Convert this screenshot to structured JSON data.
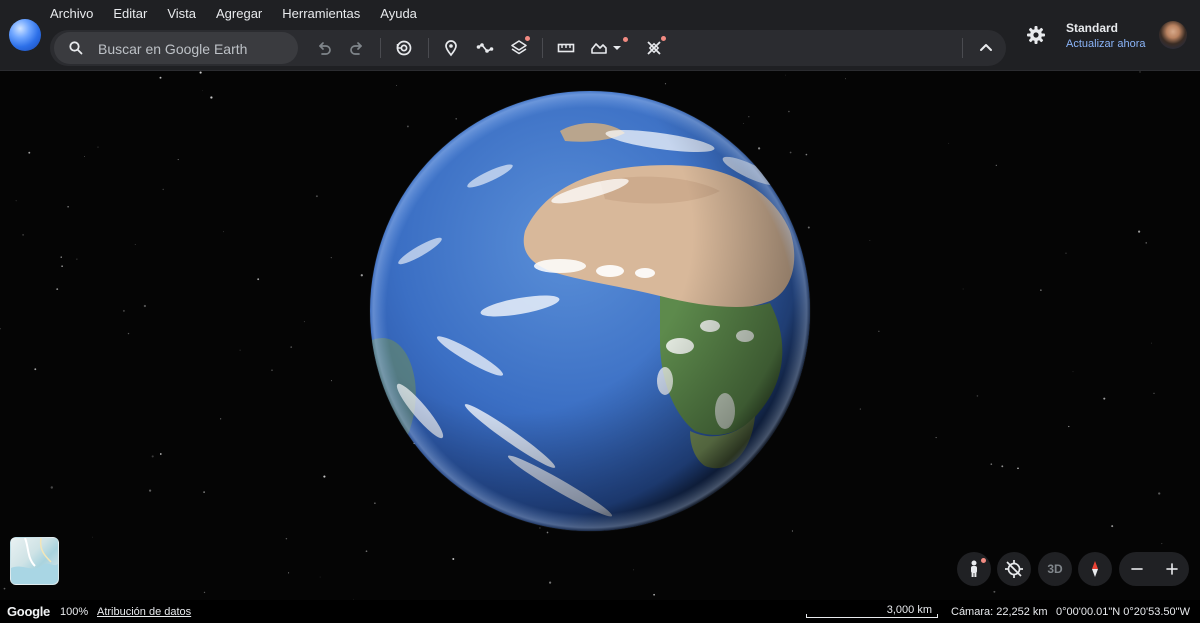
{
  "menu": [
    "Archivo",
    "Editar",
    "Vista",
    "Agregar",
    "Herramientas",
    "Ayuda"
  ],
  "search": {
    "placeholder": "Buscar en Google Earth"
  },
  "toolbar_icons": [
    "undo-icon",
    "redo-icon",
    "history-icon",
    "placemark-icon",
    "path-icon",
    "layers-icon",
    "ruler-icon",
    "elevation-icon",
    "dropdown-icon",
    "measure-tool-icon",
    "collapse-chevron-icon"
  ],
  "account": {
    "plan": "Standard",
    "update": "Actualizar ahora"
  },
  "controls": {
    "view_3d": "3D"
  },
  "status": {
    "logo": "Google",
    "zoom": "100%",
    "attribution": "Atribución de datos",
    "scale": "3,000 km",
    "camera": "Cámara: 22,252 km",
    "coords": "0°00'00.01\"N 0°20'53.50\"W"
  },
  "colors": {
    "accent_link": "#8ab4f8",
    "badge": "#f28b82",
    "ocean": "#3b6fc4"
  }
}
